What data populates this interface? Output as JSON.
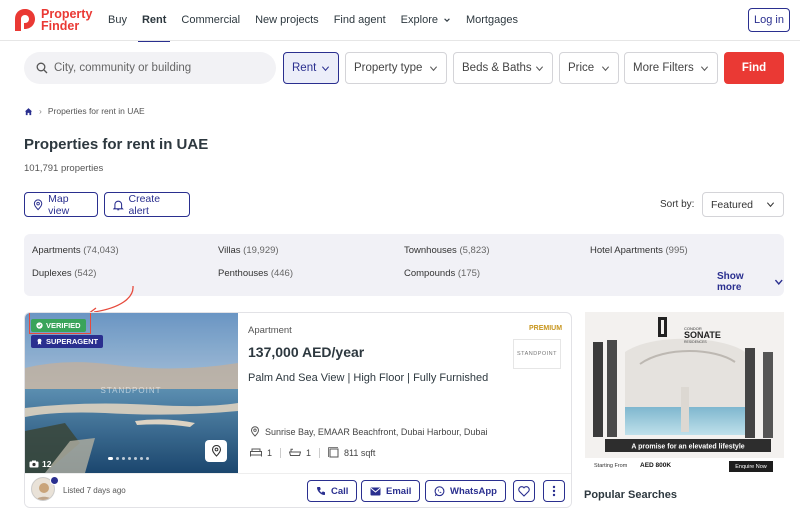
{
  "header": {
    "logo_line1": "Property",
    "logo_line2": "Finder",
    "nav": [
      {
        "label": "Buy",
        "active": false
      },
      {
        "label": "Rent",
        "active": true
      },
      {
        "label": "Commercial",
        "active": false
      },
      {
        "label": "New projects",
        "active": false
      },
      {
        "label": "Find agent",
        "active": false
      },
      {
        "label": "Explore",
        "active": false
      },
      {
        "label": "Mortgages",
        "active": false
      }
    ],
    "login": "Log in"
  },
  "search": {
    "placeholder": "City, community or building",
    "filters": [
      "Rent",
      "Property type",
      "Beds & Baths",
      "Price",
      "More Filters"
    ],
    "find": "Find"
  },
  "breadcrumb": {
    "current": "Properties for rent in UAE"
  },
  "page": {
    "title": "Properties for rent in UAE",
    "count": "101,791 properties",
    "map_view": "Map view",
    "create_alert": "Create alert",
    "sort_label": "Sort by:",
    "sort_value": "Featured"
  },
  "categories": {
    "items": [
      {
        "name": "Apartments",
        "count": "(74,043)"
      },
      {
        "name": "Villas",
        "count": "(19,929)"
      },
      {
        "name": "Townhouses",
        "count": "(5,823)"
      },
      {
        "name": "Hotel Apartments",
        "count": "(995)"
      },
      {
        "name": "Duplexes",
        "count": "(542)"
      },
      {
        "name": "Penthouses",
        "count": "(446)"
      },
      {
        "name": "Compounds",
        "count": "(175)"
      }
    ],
    "show_more": "Show more"
  },
  "listing": {
    "verified": "VERIFIED",
    "superagent": "SUPERAGENT",
    "image_count": "12",
    "type": "Apartment",
    "premium": "PREMIUM",
    "agency_name": "STANDPOINT",
    "price": "137,000 AED/year",
    "title": "Palm And Sea View | High Floor | Fully Furnished",
    "location": "Sunrise Bay, EMAAR Beachfront, Dubai Harbour, Dubai",
    "beds": "1",
    "baths": "1",
    "area": "811 sqft",
    "listed": "Listed 7 days ago",
    "actions": {
      "call": "Call",
      "email": "Email",
      "whatsapp": "WhatsApp"
    },
    "watermark": "STANDPOINT"
  },
  "ad": {
    "brand_top": "CONDOR",
    "brand": "SONATE",
    "brand_sub": "RESIDENCES",
    "tagline": "A promise for an elevated lifestyle",
    "starting": "Starting From",
    "price": "AED 800K",
    "cta": "Enquire Now"
  },
  "popular": "Popular Searches",
  "colors": {
    "brand_red": "#ea3934",
    "brand_blue": "#2a2f8f",
    "verified_green": "#3aa45a",
    "premium_gold": "#c8961e"
  }
}
